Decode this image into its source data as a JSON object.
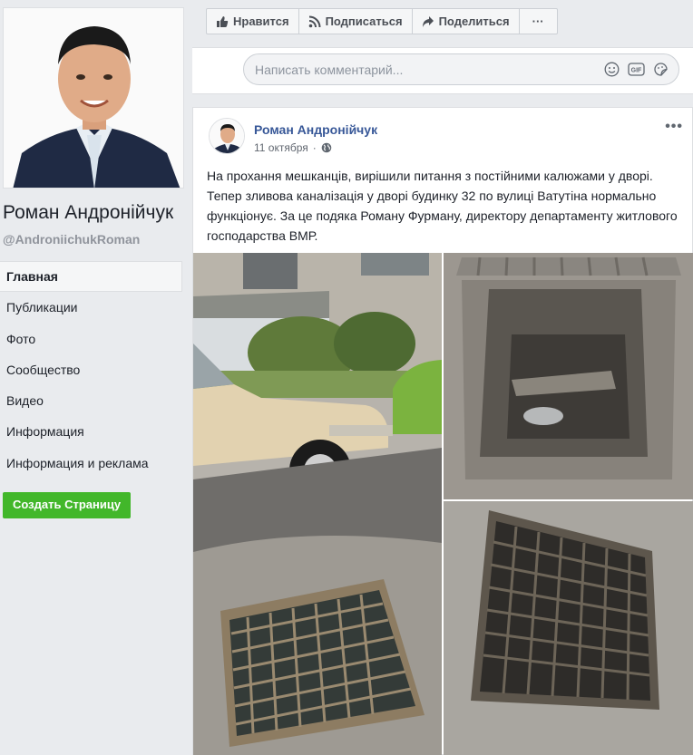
{
  "profile": {
    "name": "Роман Андронійчук",
    "handle": "@AndroniichukRoman"
  },
  "nav": [
    {
      "label": "Главная",
      "active": true
    },
    {
      "label": "Публикации"
    },
    {
      "label": "Фото"
    },
    {
      "label": "Сообщество"
    },
    {
      "label": "Видео"
    },
    {
      "label": "Информация"
    },
    {
      "label": "Информация и реклама"
    }
  ],
  "create_page_label": "Создать Страницу",
  "actions": {
    "like": "Нравится",
    "follow": "Подписаться",
    "share": "Поделиться",
    "more": "···"
  },
  "comment": {
    "placeholder": "Написать комментарий..."
  },
  "post": {
    "author": "Роман Андронійчук",
    "date": "11 октября",
    "separator": "·",
    "more": "•••",
    "text": "На прохання мешканців, вирішили питання з постійними калюжами у дворі. Тепер зливова каналізація у дворі будинку 32 по вулиці Ватутіна нормально функціонує. За це подяка Роману Фурману, директору департаменту житлового господарства ВМР."
  },
  "colors": {
    "link": "#385898",
    "green": "#42b72a",
    "bg": "#e9ebee"
  }
}
